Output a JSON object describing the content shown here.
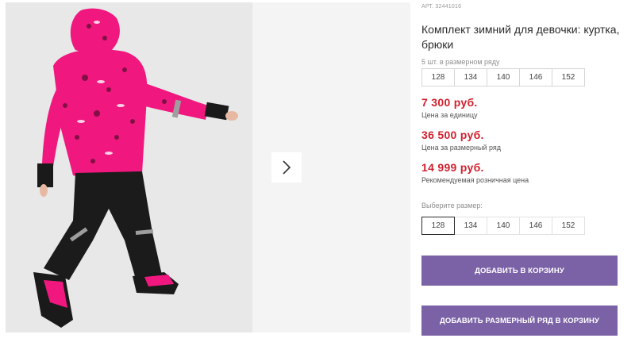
{
  "product": {
    "sku": "АРТ. 32441016",
    "title": "Комплект зимний для девочки: куртка, брюки"
  },
  "gallery": {
    "next_icon": "chevron-right-icon"
  },
  "size_pack": {
    "label": "5 шт. в размерном ряду",
    "sizes": [
      "128",
      "134",
      "140",
      "146",
      "152"
    ]
  },
  "prices": {
    "unit_price": "7 300 руб.",
    "unit_label": "Цена за единицу",
    "row_price": "36 500 руб.",
    "row_label": "Цена за размерный ряд",
    "retail_price": "14 999 руб.",
    "retail_label": "Рекомендуемая розничная цена",
    "price_color": "#d0202e"
  },
  "size_select": {
    "label": "Выберите размер:",
    "sizes": [
      "128",
      "134",
      "140",
      "146",
      "152"
    ],
    "selected": "128"
  },
  "buttons": {
    "add_to_cart": "ДОБАВИТЬ В КОРЗИНУ",
    "add_row_to_cart": "ДОБАВИТЬ РАЗМЕРНЫЙ РЯД В КОРЗИНУ",
    "accent_color": "#7b62a6"
  }
}
